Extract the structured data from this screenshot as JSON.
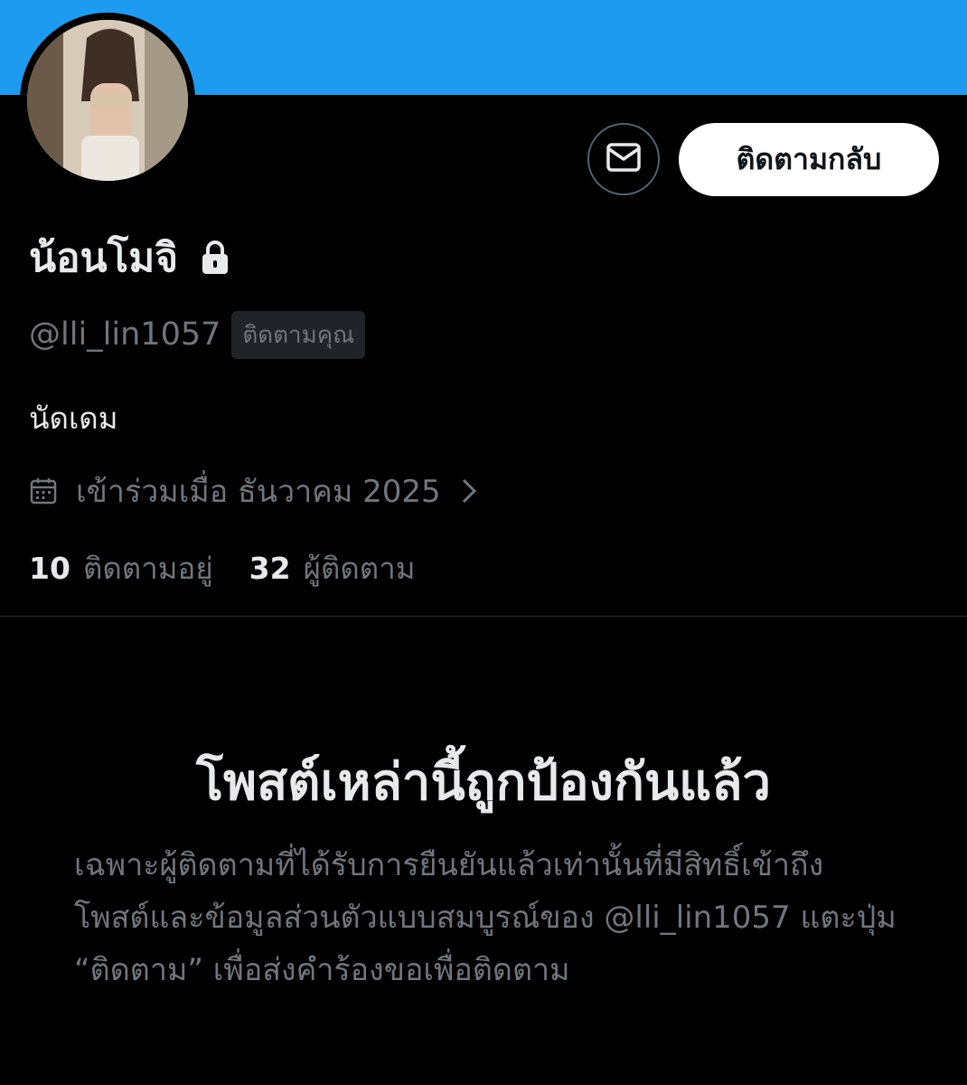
{
  "profile": {
    "display_name": "น้อนโมจิ",
    "handle": "@lli_lin1057",
    "follows_you_badge": "ติดตามคุณ",
    "bio": "นัดเดม",
    "joined": "เข้าร่วมเมื่อ ธันวาคม 2025",
    "following_count": "10",
    "following_label": "ติดตามอยู่",
    "followers_count": "32",
    "followers_label": "ผู้ติดตาม"
  },
  "actions": {
    "follow_back_label": "ติดตามกลับ",
    "message_icon": "envelope-icon"
  },
  "protected": {
    "title": "โพสต์เหล่านี้ถูกป้องกันแล้ว",
    "description": "เฉพาะผู้ติดตามที่ได้รับการยืนยันแล้วเท่านั้นที่มีสิทธิ์เข้าถึงโพสต์และข้อมูลส่วนตัวแบบสมบูรณ์ของ @lli_lin1057 แตะปุ่ม “ติดตาม” เพื่อส่งคำร้องขอเพื่อติดตาม"
  },
  "colors": {
    "banner": "#1d9bf0",
    "background": "#000000",
    "primary_text": "#e7e9ea",
    "secondary_text": "#71767b",
    "button_bg": "#ffffff"
  }
}
